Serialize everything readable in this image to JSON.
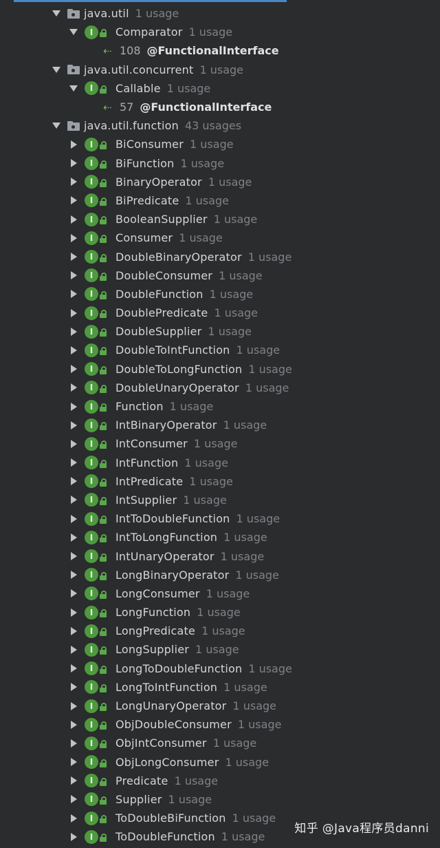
{
  "packages": [
    {
      "name": "java.util",
      "usage": "1 usage",
      "children": [
        {
          "name": "Comparator",
          "usage": "1 usage",
          "ref": {
            "line": "108",
            "annotation": "@FunctionalInterface"
          }
        }
      ]
    },
    {
      "name": "java.util.concurrent",
      "usage": "1 usage",
      "children": [
        {
          "name": "Callable",
          "usage": "1 usage",
          "ref": {
            "line": "57",
            "annotation": "@FunctionalInterface"
          }
        }
      ]
    },
    {
      "name": "java.util.function",
      "usage": "43 usages",
      "children": [
        {
          "name": "BiConsumer",
          "usage": "1 usage"
        },
        {
          "name": "BiFunction",
          "usage": "1 usage"
        },
        {
          "name": "BinaryOperator",
          "usage": "1 usage"
        },
        {
          "name": "BiPredicate",
          "usage": "1 usage"
        },
        {
          "name": "BooleanSupplier",
          "usage": "1 usage"
        },
        {
          "name": "Consumer",
          "usage": "1 usage"
        },
        {
          "name": "DoubleBinaryOperator",
          "usage": "1 usage"
        },
        {
          "name": "DoubleConsumer",
          "usage": "1 usage"
        },
        {
          "name": "DoubleFunction",
          "usage": "1 usage"
        },
        {
          "name": "DoublePredicate",
          "usage": "1 usage"
        },
        {
          "name": "DoubleSupplier",
          "usage": "1 usage"
        },
        {
          "name": "DoubleToIntFunction",
          "usage": "1 usage"
        },
        {
          "name": "DoubleToLongFunction",
          "usage": "1 usage"
        },
        {
          "name": "DoubleUnaryOperator",
          "usage": "1 usage"
        },
        {
          "name": "Function",
          "usage": "1 usage"
        },
        {
          "name": "IntBinaryOperator",
          "usage": "1 usage"
        },
        {
          "name": "IntConsumer",
          "usage": "1 usage"
        },
        {
          "name": "IntFunction",
          "usage": "1 usage"
        },
        {
          "name": "IntPredicate",
          "usage": "1 usage"
        },
        {
          "name": "IntSupplier",
          "usage": "1 usage"
        },
        {
          "name": "IntToDoubleFunction",
          "usage": "1 usage"
        },
        {
          "name": "IntToLongFunction",
          "usage": "1 usage"
        },
        {
          "name": "IntUnaryOperator",
          "usage": "1 usage"
        },
        {
          "name": "LongBinaryOperator",
          "usage": "1 usage"
        },
        {
          "name": "LongConsumer",
          "usage": "1 usage"
        },
        {
          "name": "LongFunction",
          "usage": "1 usage"
        },
        {
          "name": "LongPredicate",
          "usage": "1 usage"
        },
        {
          "name": "LongSupplier",
          "usage": "1 usage"
        },
        {
          "name": "LongToDoubleFunction",
          "usage": "1 usage"
        },
        {
          "name": "LongToIntFunction",
          "usage": "1 usage"
        },
        {
          "name": "LongUnaryOperator",
          "usage": "1 usage"
        },
        {
          "name": "ObjDoubleConsumer",
          "usage": "1 usage"
        },
        {
          "name": "ObjIntConsumer",
          "usage": "1 usage"
        },
        {
          "name": "ObjLongConsumer",
          "usage": "1 usage"
        },
        {
          "name": "Predicate",
          "usage": "1 usage"
        },
        {
          "name": "Supplier",
          "usage": "1 usage"
        },
        {
          "name": "ToDoubleBiFunction",
          "usage": "1 usage"
        },
        {
          "name": "ToDoubleFunction",
          "usage": "1 usage"
        }
      ]
    }
  ],
  "icons": {
    "interface_letter": "I",
    "expanded": "chevron-down-icon",
    "collapsed": "chevron-right-icon",
    "package": "package-icon",
    "interface": "interface-icon",
    "lock": "lock-icon",
    "reference": "reference-arrow-icon"
  },
  "colors": {
    "background": "#2b2c2e",
    "interface_icon": "#4e9a3f",
    "usage_text": "#7f8286",
    "name_text": "#d3d5d8"
  },
  "watermark": "知乎 @Java程序员danni"
}
